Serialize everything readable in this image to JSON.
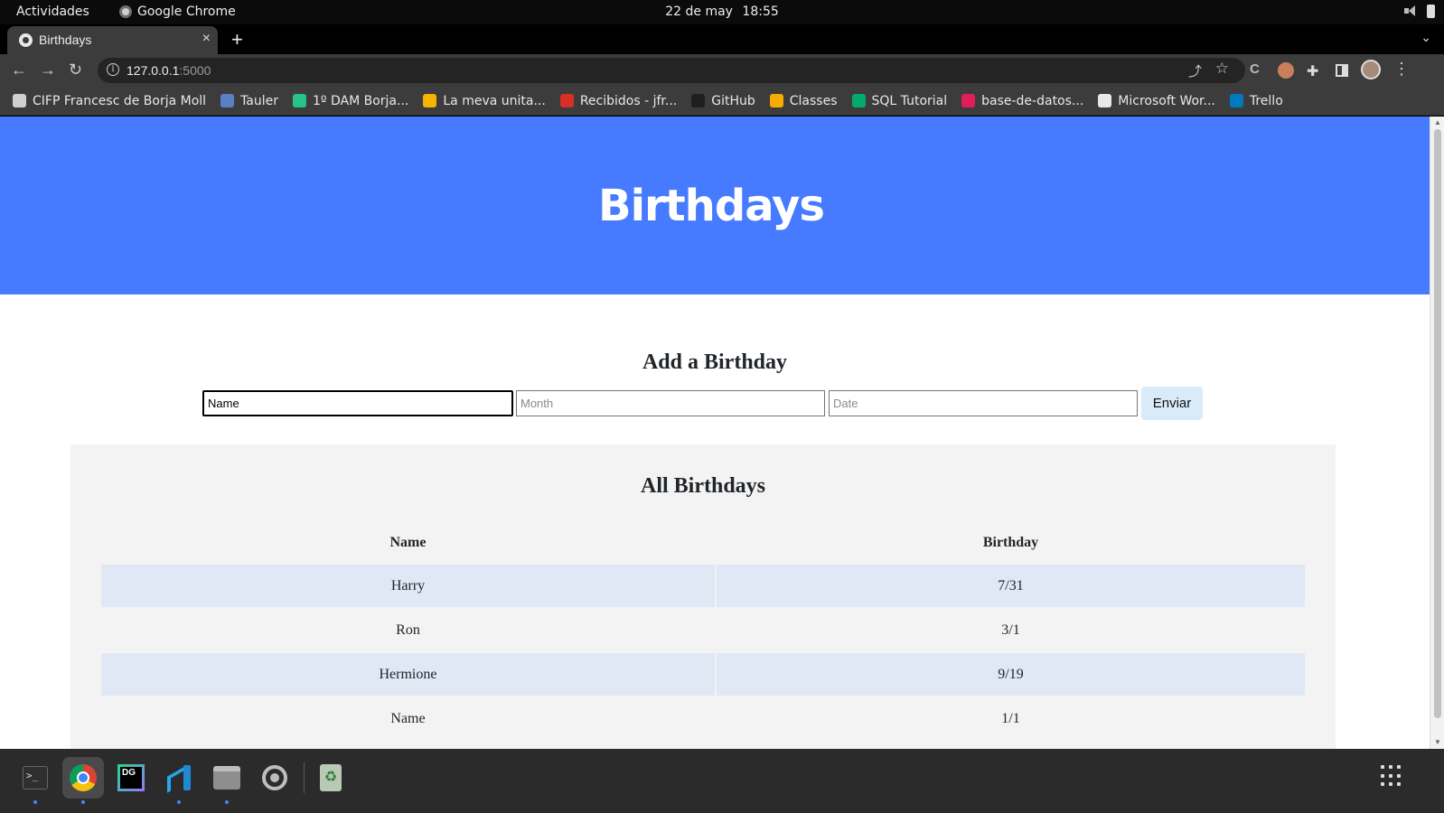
{
  "os_bar": {
    "activities": "Actividades",
    "app_name": "Google Chrome",
    "date": "22 de may",
    "time": "18:55"
  },
  "browser": {
    "tab_title": "Birthdays",
    "close_glyph": "×",
    "new_tab_glyph": "+",
    "tab_menu_glyph": "⌄",
    "url_host": "127.0.0.1",
    "url_port": ":5000",
    "back_glyph": "←",
    "forward_glyph": "→",
    "reload_glyph": "↻",
    "star_glyph": "☆",
    "share_glyph": "⤴",
    "menu_glyph": "⋮"
  },
  "bookmarks": [
    {
      "label": "CIFP Francesc de Borja Moll",
      "icon": "folder-icon",
      "color": "#cfcfcf"
    },
    {
      "label": "Tauler",
      "icon": "tauler-icon",
      "color": "#5b7fc4"
    },
    {
      "label": "1º DAM Borja...",
      "icon": "pinwheel-icon",
      "color": "#27c28a"
    },
    {
      "label": "La meva unita...",
      "icon": "google-drive-icon",
      "color": "#f4b400"
    },
    {
      "label": "Recibidos - jfr...",
      "icon": "gmail-icon",
      "color": "#d93025"
    },
    {
      "label": "GitHub",
      "icon": "github-icon",
      "color": "#1f1f1f"
    },
    {
      "label": "Classes",
      "icon": "google-classroom-icon",
      "color": "#f9ab00"
    },
    {
      "label": "SQL Tutorial",
      "icon": "w3schools-icon",
      "color": "#04aa6d"
    },
    {
      "label": "base-de-datos...",
      "icon": "slack-icon",
      "color": "#e01e5a"
    },
    {
      "label": "Microsoft Wor...",
      "icon": "globe-icon",
      "color": "#e8e8e8"
    },
    {
      "label": "Trello",
      "icon": "trello-icon",
      "color": "#0079bf"
    }
  ],
  "page": {
    "header_title": "Birthdays",
    "header_color": "#477bff",
    "add_title": "Add a Birthday",
    "form": {
      "name_value": "Name",
      "month_placeholder": "Month",
      "date_placeholder": "Date",
      "submit_label": "Enviar"
    },
    "list_title": "All Birthdays",
    "table": {
      "headers": [
        "Name",
        "Birthday"
      ],
      "rows": [
        [
          "Harry",
          "7/31"
        ],
        [
          "Ron",
          "3/1"
        ],
        [
          "Hermione",
          "9/19"
        ],
        [
          "Name",
          "1/1"
        ]
      ]
    }
  },
  "dock": {
    "apps": [
      "terminal-icon",
      "chrome-icon",
      "datagrip-icon",
      "vscode-icon",
      "files-icon",
      "settings-icon",
      "trash-icon"
    ],
    "terminal_prompt": ">_",
    "datagrip_label": "DG",
    "trash_glyph": "♻"
  }
}
